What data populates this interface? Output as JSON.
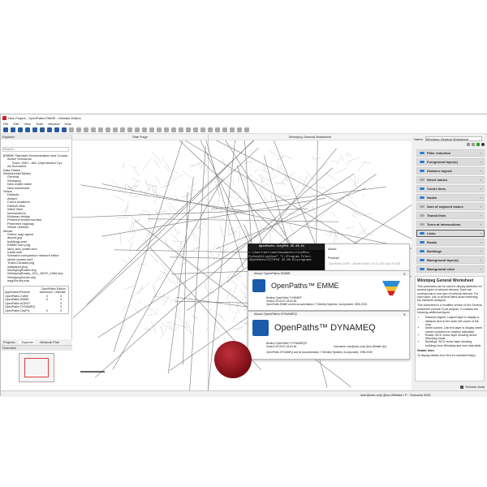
{
  "window": {
    "title": "New Project - OpenPaths EMME - Ultimate Edition"
  },
  "menu": [
    "File",
    "Edit",
    "View",
    "Tools",
    "Window",
    "Help"
  ],
  "explorer": {
    "title": "Explorer",
    "search_placeholder": "Search...",
    "tree": [
      {
        "label": "[EMME Standard Demonstration and Course",
        "lvl": 0
      },
      {
        "label": "Active Scenarios",
        "lvl": 1
      },
      {
        "label": "Scen. 3001 - AM: Unprotected Cyc",
        "lvl": 2
      },
      {
        "label": "All Scenarios",
        "lvl": 1
      },
      {
        "label": "Data Tables",
        "lvl": 0
      },
      {
        "label": "Worksheets/Tables",
        "lvl": 0
      },
      {
        "label": "General",
        "lvl": 1
      },
      {
        "label": "Winnipeg",
        "lvl": 1
      },
      {
        "label": "New matrix table",
        "lvl": 1
      },
      {
        "label": "New worksheet",
        "lvl": 1
      },
      {
        "label": "Views",
        "lvl": 0
      },
      {
        "label": "Districts",
        "lvl": 1
      },
      {
        "label": "Airport",
        "lvl": 1
      },
      {
        "label": "Count locations",
        "lvl": 1
      },
      {
        "label": "Default view",
        "lvl": 1
      },
      {
        "label": "Initial View",
        "lvl": 1
      },
      {
        "label": "Intersections",
        "lvl": 1
      },
      {
        "label": "Kildonan bridge",
        "lvl": 1
      },
      {
        "label": "Pembina transit corridor",
        "lvl": 1
      },
      {
        "label": "Perimeter highway",
        "lvl": 1
      },
      {
        "label": "Whole network",
        "lvl": 1
      },
      {
        "label": "Media",
        "lvl": 0
      },
      {
        "label": "Online map layers",
        "lvl": 1
      },
      {
        "label": "airport.jpg",
        "lvl": 1
      },
      {
        "label": "buildings.wml",
        "lvl": 1
      },
      {
        "label": "EMME icon.png",
        "lvl": 1
      },
      {
        "label": "land_and_water.wml",
        "lvl": 1
      },
      {
        "label": "roads.wml",
        "lvl": 1
      },
      {
        "label": "Scenario comparison network editor",
        "lvl": 1
      },
      {
        "label": "street names.wml",
        "lvl": 1
      },
      {
        "label": "Trans-Canada.png",
        "lvl": 1
      },
      {
        "label": "wallpaper.png",
        "lvl": 1
      },
      {
        "label": "WinnipegRoads.shp",
        "lvl": 1
      },
      {
        "label": "WinnipegRoads_XCL_WGS_1984.shp",
        "lvl": 1
      },
      {
        "label": "WinnipegZones.shp",
        "lvl": 1
      },
      {
        "label": "wpgSurvey.shp",
        "lvl": 1
      }
    ],
    "comparison": {
      "header_group": "OpenPaths Edition",
      "columns": [
        "Application/Feature",
        "Advanced",
        "Ultimate"
      ],
      "rows": [
        [
          "OpenPaths CUBE",
          "X",
          "X"
        ],
        [
          "OpenPaths EMME",
          "X",
          "X"
        ],
        [
          "OpenPaths AGENT",
          "",
          "X"
        ],
        [
          "OpenPaths DYNAMEQ",
          "",
          "X"
        ],
        [
          "OpenPaths CityPhi",
          "X",
          "X"
        ]
      ]
    }
  },
  "bottom_tabs": [
    "Projects",
    "Explorer",
    "Network Pilot"
  ],
  "overview": {
    "title": "Overview"
  },
  "tabs": {
    "start": "Start Page",
    "worksheet": "Winnipeg General Worksheet"
  },
  "right": {
    "name_label": "Name:",
    "name_value": "Winnipeg General Worksheet",
    "layers": [
      {
        "label": "Filter reduction",
        "on": true
      },
      {
        "label": "Foreground layer(s)",
        "on": true
      },
      {
        "label": "Distance legend",
        "on": true
      },
      {
        "label": "Street names",
        "on": false
      },
      {
        "label": "Centre lines",
        "on": true
      },
      {
        "label": "Nodes",
        "on": true
      },
      {
        "label": "Sum of segment values",
        "on": false
      },
      {
        "label": "Transit lines",
        "on": false
      },
      {
        "label": "Turns at intersections",
        "on": false
      },
      {
        "label": "Links",
        "on": true
      },
      {
        "label": "Roads",
        "on": true
      },
      {
        "label": "Buildings",
        "on": true
      },
      {
        "label": "Background layer(s)",
        "on": true
      },
      {
        "label": "Background color",
        "on": true
      }
    ],
    "desc_title": "Winnipeg General Worksheet",
    "desc_p1": "This worksheet can be used to display attributes for several types of network element. Each tab corresponds to one type of network element. For each layer, one or several filters allow restricting the elements analyzed.",
    "desc_p2": "This worksheet is a modified version of the General worksheet (version 0) all projects. It contains the following additional layers:",
    "bullets": [
      "Distance legend: Legend layer to display a distance item in the lower left corner of the map.",
      "Street names: Link text layer to display street names contained in roadline data table.",
      "Roads: WCS vector layer showing all the Winnipeg roads.",
      "Buildings: WCS vector layer showing buildings from Winnipeg and user data table."
    ],
    "desc_sub": "Header lines",
    "desc_sub_text": "To display details from Text Do selected link(s)",
    "refresh": "Refresh Data"
  },
  "terminal": {
    "title": "OpenPaths CityPhi 25.00.01",
    "lines": [
      "C:\\Users\\William\\Documents\\CityPhi>",
      "Python311\\python\" \"C:\\Program Files\\",
      "\\OpenPaths\\CITYPHI 25.00.01\\programs"
    ]
  },
  "about_cube": {
    "about": "About",
    "product": "Product",
    "product_line": "OpenPaths CUBE - Ultimate Edition | 25.0.1.000 | Apr 29 2025"
  },
  "about_emme": {
    "title": "About OpenPaths EMME",
    "brand": "OpenPaths",
    "product": "EMME",
    "l1": "Bentley OpenPaths™ EMME®",
    "l2": "Version 25.00.01.06 64-bit",
    "l3": "OpenPaths EMME and its documentation, © Bentley Systems, Incorporated, 1980-2025."
  },
  "about_dyn": {
    "title": "About OpenPaths DYNAMEQ",
    "brand": "OpenPaths",
    "product": "DYNAMEQ",
    "l1": "Bentley OpenPaths™ DYNAMEQ®",
    "l2": "Version 25.00.01.06 64-bit",
    "username": "Username:  user@edu (only @cs.Ultimate (6))",
    "l3": "OpenPaths DYNAMEQ and its documentation, © Bentley Systems, Incorporated, 1996-2025."
  },
  "status": {
    "user": "user@edu.only @cs.Ultimate / P · Scenario 3001"
  },
  "colors": {
    "accent": "#2f7bd6",
    "brand": "#1a5bab",
    "logo": "#c8262e"
  }
}
